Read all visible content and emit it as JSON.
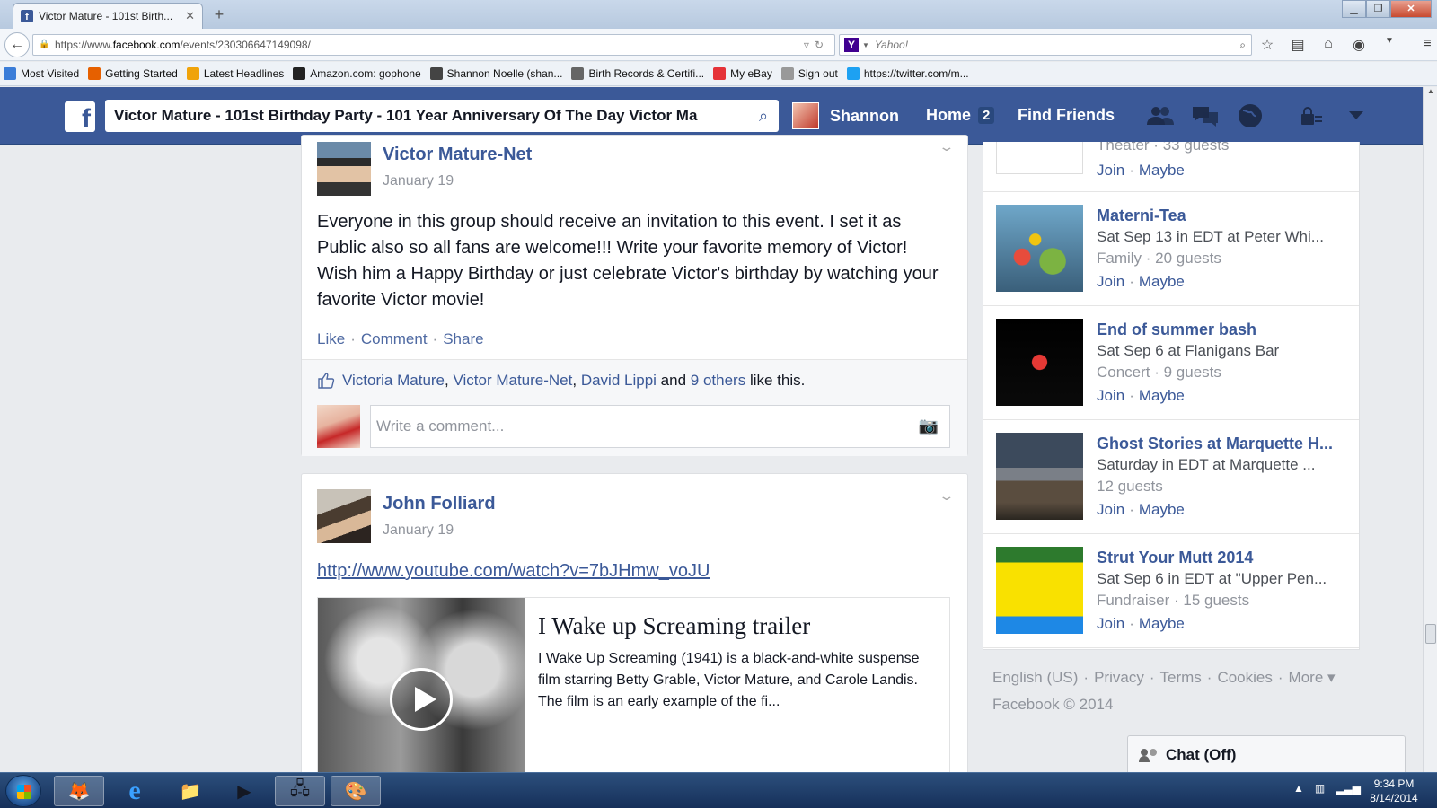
{
  "browser": {
    "tab_title": "Victor Mature - 101st Birth...",
    "url_prefix": "https://www.",
    "url_domain": "facebook.com",
    "url_path": "/events/230306647149098/",
    "search_engine": "Yahoo!",
    "bookmarks": [
      {
        "label": "Most Visited",
        "icon": "bookmark-folder-icon",
        "color": "#3b7dd8"
      },
      {
        "label": "Getting Started",
        "icon": "firefox-icon",
        "color": "#e66000"
      },
      {
        "label": "Latest Headlines",
        "icon": "rss-icon",
        "color": "#f0a30a"
      },
      {
        "label": "Amazon.com: gophone",
        "icon": "amazon-icon",
        "color": "#222222"
      },
      {
        "label": "Shannon Noelle (shan...",
        "icon": "people-icon",
        "color": "#444444"
      },
      {
        "label": "Birth Records & Certifi...",
        "icon": "rb-icon",
        "color": "#666666"
      },
      {
        "label": "My eBay",
        "icon": "ebay-icon",
        "color": "#e53238"
      },
      {
        "label": "Sign out",
        "icon": "page-icon",
        "color": "#999999"
      },
      {
        "label": "https://twitter.com/m...",
        "icon": "twitter-icon",
        "color": "#1da1f2"
      }
    ]
  },
  "fb": {
    "search_query": "Victor Mature - 101st Birthday Party - 101 Year Anniversary Of The Day Victor Ma",
    "user_name": "Shannon",
    "home_label": "Home",
    "home_count": "2",
    "find_friends": "Find Friends"
  },
  "post1": {
    "author": "Victor Mature-Net",
    "date": "January 19",
    "text": "Everyone in this group should receive an invitation to this event. I set it as Public also so all fans are welcome!!! Write your favorite memory of Victor! Wish him a Happy Birthday or just celebrate Victor's birthday by watching your favorite Victor movie!",
    "like": "Like",
    "comment": "Comment",
    "share": "Share",
    "likers": [
      "Victoria Mature",
      "Victor Mature-Net",
      "David Lippi"
    ],
    "and_text": "and",
    "others": "9 others",
    "like_this": "like this.",
    "comment_placeholder": "Write a comment..."
  },
  "post2": {
    "author": "John Folliard",
    "date": "January 19",
    "link": "http://www.youtube.com/watch?v=7bJHmw_voJU",
    "video_title": "I Wake up Screaming trailer",
    "video_desc": "I Wake Up Screaming (1941) is a black-and-white suspense film starring Betty Grable, Victor Mature, and Carole Landis. The film is an early example of the fi..."
  },
  "events": {
    "join": "Join",
    "maybe": "Maybe",
    "partial": {
      "line": "Theater · 33 guests"
    },
    "items": [
      {
        "title": "Materni-Tea",
        "line1": "Sat Sep 13 in EDT at Peter Whi...",
        "line2": "Family · 20 guests"
      },
      {
        "title": "End of summer bash",
        "line1": "Sat Sep 6 at Flanigans Bar",
        "line2": "Concert · 9 guests"
      },
      {
        "title": "Ghost Stories at Marquette H...",
        "line1": "Saturday in EDT at Marquette ...",
        "line2": "12 guests"
      },
      {
        "title": "Strut Your Mutt 2014",
        "line1": "Sat Sep 6 in EDT at \"Upper Pen...",
        "line2": "Fundraiser · 15 guests"
      }
    ]
  },
  "footer": {
    "language": "English (US)",
    "privacy": "Privacy",
    "terms": "Terms",
    "cookies": "Cookies",
    "more": "More ▾",
    "copyright": "Facebook © 2014"
  },
  "chat": {
    "label": "Chat (Off)"
  },
  "taskbar": {
    "time": "9:34 PM",
    "date": "8/14/2014"
  }
}
